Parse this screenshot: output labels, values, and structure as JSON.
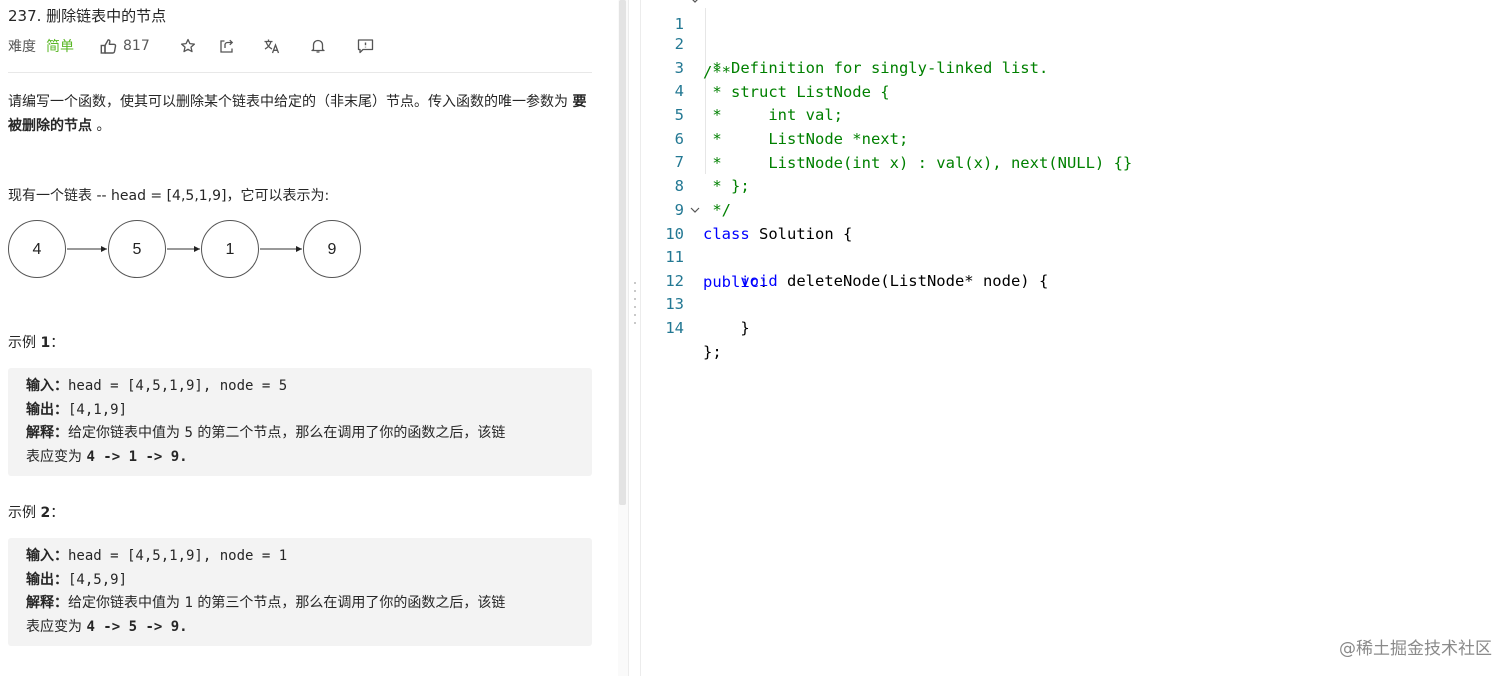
{
  "problem": {
    "title": "237. 删除链表中的节点",
    "difficulty_label": "难度",
    "difficulty_value": "简单",
    "likes": "817",
    "description_part1": "请编写一个函数，使其可以删除某个链表中给定的（非末尾）节点。传入函数的唯一参数为 ",
    "description_bold": "要被删除的节点",
    "description_part2": " 。",
    "intro": "现有一个链表 -- head = [4,5,1,9]，它可以表示为:",
    "nodes": [
      "4",
      "5",
      "1",
      "9"
    ],
    "examples": [
      {
        "heading": "示例 ",
        "heading_num": "1",
        "heading_colon": "：",
        "input_label": "输入：",
        "input_value": "head = [4,5,1,9], node = 5",
        "output_label": "输出：",
        "output_value": "[4,1,9]",
        "explain_label": "解释：",
        "explain_part1": "给定你链表中值为 ",
        "explain_num": "5",
        "explain_part2": " 的第二个节点，那么在调用了你的函数之后，该链",
        "explain_part3": "表应变为 ",
        "explain_result": "4 -> 1 -> 9."
      },
      {
        "heading": "示例 ",
        "heading_num": "2",
        "heading_colon": "：",
        "input_label": "输入：",
        "input_value": "head = [4,5,1,9], node = 1",
        "output_label": "输出：",
        "output_value": "[4,5,9]",
        "explain_label": "解释：",
        "explain_part1": "给定你链表中值为 ",
        "explain_num": "1",
        "explain_part2": " 的第三个节点，那么在调用了你的函数之后，该链",
        "explain_part3": "表应变为 ",
        "explain_result": "4 -> 5 -> 9."
      }
    ]
  },
  "code": {
    "line_numbers": [
      "1",
      "2",
      "3",
      "4",
      "5",
      "6",
      "7",
      "8",
      "9",
      "10",
      "11",
      "12",
      "13",
      "14"
    ],
    "lines": {
      "l1": "/**",
      "l2": " * Definition for singly-linked list.",
      "l3": " * struct ListNode {",
      "l4": " *     int val;",
      "l5": " *     ListNode *next;",
      "l6": " *     ListNode(int x) : val(x), next(NULL) {}",
      "l7": " * };",
      "l8": " */",
      "l9_kw": "class",
      "l9_rest": " Solution {",
      "l10_kw": "public",
      "l10_rest": ":",
      "l11_indent": "    ",
      "l11_kw": "void",
      "l11_rest": " deleteNode(ListNode* node) {",
      "l12": "",
      "l13": "    }",
      "l14": "};"
    }
  },
  "watermark": "@稀土掘金技术社区",
  "colors": {
    "difficulty_easy": "#5ab726",
    "comment": "#008000",
    "keyword": "#0000ff",
    "line_number": "#237893"
  }
}
